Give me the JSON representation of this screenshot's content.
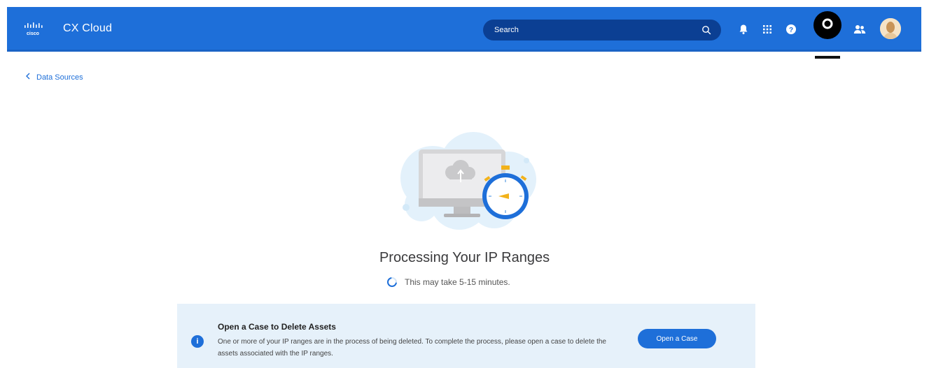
{
  "header": {
    "logo_text": "cisco",
    "app_title": "CX Cloud",
    "search_placeholder": "Search",
    "icons": [
      "search-icon",
      "bell-icon",
      "apps-grid-icon",
      "help-icon",
      "settings-icon",
      "users-icon",
      "user-avatar"
    ]
  },
  "breadcrumb": {
    "label": "Data Sources"
  },
  "status": {
    "title": "Processing Your IP Ranges",
    "subtitle": "This may take 5-15 minutes."
  },
  "notice": {
    "title": "Open a Case to Delete Assets",
    "body": "One or more of your IP ranges are in the process of being deleted. To complete the process, please open a case to delete the assets associated with the IP ranges.",
    "button_label": "Open a Case"
  },
  "colors": {
    "brand_blue": "#1e6fd9",
    "search_bg": "#0b3f93",
    "banner_bg": "#e6f1fa",
    "accent_yellow": "#f2b21b"
  }
}
